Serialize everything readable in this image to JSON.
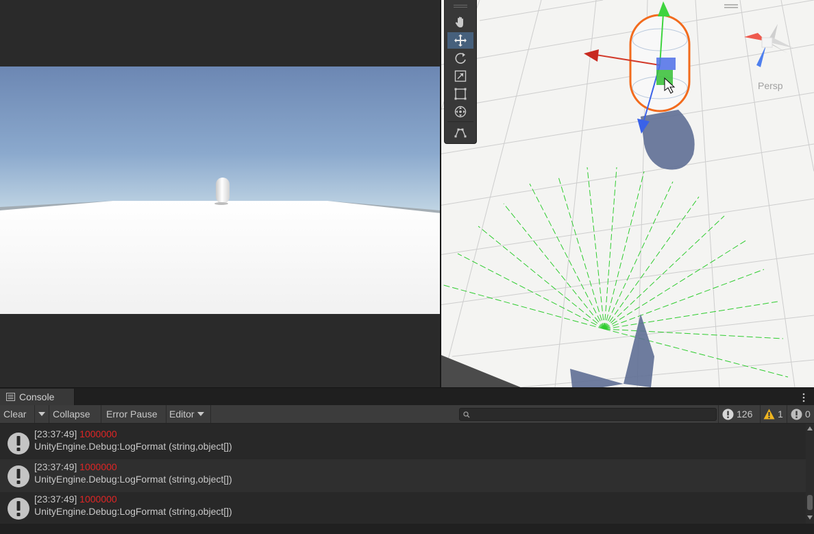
{
  "console": {
    "tab_label": "Console",
    "toolbar": {
      "clear": "Clear",
      "collapse": "Collapse",
      "error_pause": "Error Pause",
      "editor": "Editor"
    },
    "search": {
      "placeholder": "",
      "value": ""
    },
    "counts": {
      "log": "126",
      "warning": "1",
      "error": "0"
    },
    "entries": [
      {
        "time": "[23:37:49]",
        "message": "1000000",
        "trace": "UnityEngine.Debug:LogFormat (string,object[])"
      },
      {
        "time": "[23:37:49]",
        "message": "1000000",
        "trace": "UnityEngine.Debug:LogFormat (string,object[])"
      },
      {
        "time": "[23:37:49]",
        "message": "1000000",
        "trace": "UnityEngine.Debug:LogFormat (string,object[])"
      }
    ]
  },
  "scene": {
    "projection_label": "Persp"
  },
  "tools": [
    {
      "name": "hand-tool",
      "icon": "hand-icon",
      "active": false
    },
    {
      "name": "move-tool",
      "icon": "move-icon",
      "active": true
    },
    {
      "name": "rotate-tool",
      "icon": "rotate-icon",
      "active": false
    },
    {
      "name": "scale-tool",
      "icon": "scale-icon",
      "active": false
    },
    {
      "name": "rect-tool",
      "icon": "rect-icon",
      "active": false
    },
    {
      "name": "transform-tool",
      "icon": "transform-icon",
      "active": false
    },
    {
      "name": "custom-tool",
      "icon": "custom-tool-icon",
      "active": false
    }
  ],
  "colors": {
    "selection_outline": "#f26b1d",
    "error_value": "#e02525",
    "active_tool": "#46607c",
    "gizmo_x": "#d23a2a",
    "gizmo_y": "#3fd43f",
    "gizmo_z": "#3a62e8"
  }
}
